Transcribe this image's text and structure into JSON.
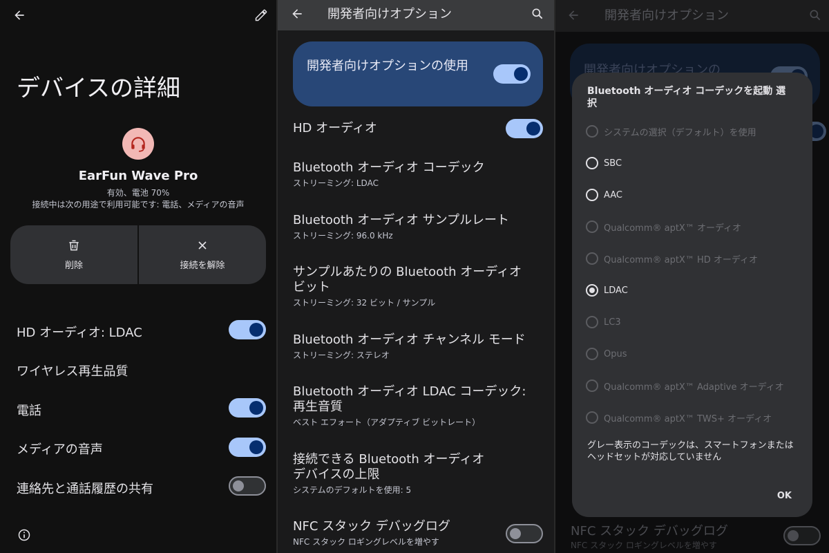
{
  "panel1": {
    "page_title": "デバイスの詳細",
    "device_name": "EarFun Wave Pro",
    "device_status": "有効、電池 70%",
    "device_usage": "接続中は次の用途で利用可能です: 電話、メディアの音声",
    "actions": {
      "delete": "削除",
      "disconnect": "接続を解除"
    },
    "rows": [
      {
        "label": "HD オーディオ: LDAC",
        "toggle": "on"
      },
      {
        "label": "ワイヤレス再生品質"
      },
      {
        "label": "電話",
        "toggle": "on"
      },
      {
        "label": "メディアの音声",
        "toggle": "on"
      },
      {
        "label": "連絡先と通話履歴の共有",
        "toggle": "off"
      }
    ]
  },
  "panel2": {
    "title": "開発者向けオプション",
    "main_switch": {
      "label": "開発者向けオプションの使用",
      "toggle": "on"
    },
    "items": [
      {
        "title": "HD オーディオ",
        "toggle": "on"
      },
      {
        "title": "Bluetooth オーディオ コーデック",
        "sub": "ストリーミング: LDAC"
      },
      {
        "title": "Bluetooth オーディオ サンプルレート",
        "sub": "ストリーミング: 96.0 kHz"
      },
      {
        "title": "サンプルあたりの Bluetooth オーディオ ビット",
        "sub": "ストリーミング: 32 ビット / サンプル"
      },
      {
        "title": "Bluetooth オーディオ チャンネル モード",
        "sub": "ストリーミング: ステレオ"
      },
      {
        "title": "Bluetooth オーディオ LDAC コーデック: 再生音質",
        "sub": "ベスト エフォート（アダプティブ ビットレート）"
      },
      {
        "title": "接続できる Bluetooth オーディオ デバイスの上限",
        "sub": "システムのデフォルトを使用: 5"
      },
      {
        "title": "NFC スタック デバッグログ",
        "sub": "NFC スタック ロギングレベルを増やす",
        "toggle": "off"
      }
    ]
  },
  "panel3": {
    "title": "開発者向けオプション",
    "behind_card_label": "開発者向けオプションの",
    "behind_nfc_title": "NFC スタック デバッグログ",
    "behind_nfc_sub": "NFC スタック ロギングレベルを増やす",
    "dialog": {
      "title": "Bluetooth オーディオ コーデックを起動 選択",
      "options": [
        {
          "label": "システムの選択（デフォルト）を使用",
          "enabled": false,
          "selected": false
        },
        {
          "label": "SBC",
          "enabled": true,
          "selected": false
        },
        {
          "label": "AAC",
          "enabled": true,
          "selected": false
        },
        {
          "label": "Qualcomm® aptX™ オーディオ",
          "enabled": false,
          "selected": false
        },
        {
          "label": "Qualcomm® aptX™ HD オーディオ",
          "enabled": false,
          "selected": false
        },
        {
          "label": "LDAC",
          "enabled": true,
          "selected": true
        },
        {
          "label": "LC3",
          "enabled": false,
          "selected": false
        },
        {
          "label": "Opus",
          "enabled": false,
          "selected": false
        },
        {
          "label": "Qualcomm® aptX™ Adaptive オーディオ",
          "enabled": false,
          "selected": false
        },
        {
          "label": "Qualcomm® aptX™ TWS+ オーディオ",
          "enabled": false,
          "selected": false
        }
      ],
      "note": "グレー表示のコーデックは、スマートフォンまたはヘッドセットが対応していません",
      "ok": "OK"
    }
  },
  "colors": {
    "toggle_on_track": "#a8c7fa",
    "toggle_on_thumb": "#062e6f",
    "main_card": "#284777",
    "avatar_bg": "#f2b8b5",
    "avatar_icon": "#b3261e"
  }
}
